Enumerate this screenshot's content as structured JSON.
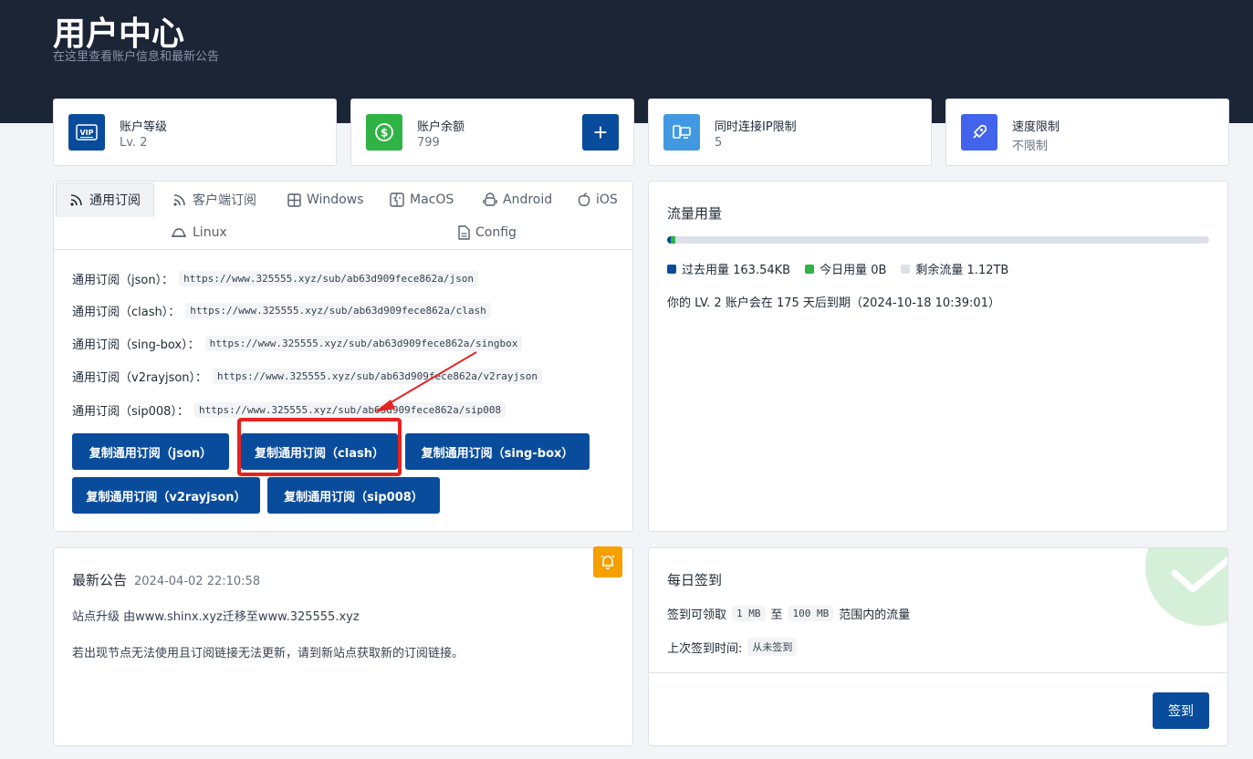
{
  "header": {
    "title": "用户中心",
    "subtitle": "在这里查看账户信息和最新公告"
  },
  "stats": [
    {
      "label": "账户等级",
      "value": "Lv. 2",
      "icon": "vip-icon",
      "color": "#0a4c9c"
    },
    {
      "label": "账户余额",
      "value": "799",
      "icon": "dollar-icon",
      "color": "#2fb344",
      "action": "+"
    },
    {
      "label": "同时连接IP限制",
      "value": "5",
      "icon": "devices-icon",
      "color": "#4299e1"
    },
    {
      "label": "速度限制",
      "value": "不限制",
      "icon": "rocket-icon",
      "color": "#4263eb"
    }
  ],
  "tabs": [
    "通用订阅",
    "客户端订阅",
    "Windows",
    "MacOS",
    "Android",
    "iOS",
    "Linux",
    "Config"
  ],
  "subscriptions": [
    {
      "label": "通用订阅（json）：",
      "url": "https://www.325555.xyz/sub/ab63d909fece862a/json"
    },
    {
      "label": "通用订阅（clash）：",
      "url": "https://www.325555.xyz/sub/ab63d909fece862a/clash"
    },
    {
      "label": "通用订阅（sing-box）：",
      "url": "https://www.325555.xyz/sub/ab63d909fece862a/singbox"
    },
    {
      "label": "通用订阅（v2rayjson）：",
      "url": "https://www.325555.xyz/sub/ab63d909fece862a/v2rayjson"
    },
    {
      "label": "通用订阅（sip008）：",
      "url": "https://www.325555.xyz/sub/ab63d909fece862a/sip008"
    }
  ],
  "copy_buttons": [
    "复制通用订阅（json）",
    "复制通用订阅（clash）",
    "复制通用订阅（sing-box）",
    "复制通用订阅（v2rayjson）",
    "复制通用订阅（sip008）"
  ],
  "traffic": {
    "title": "流量用量",
    "used_fraction": 0.001,
    "today_fraction": 0.0,
    "legend": {
      "past": "过去用量 163.54KB",
      "today": "今日用量 0B",
      "remaining": "剩余流量 1.12TB"
    },
    "colors": {
      "past": "#0a4c9c",
      "today": "#2fb344",
      "remaining": "#dde1e7"
    },
    "expire_text": "你的 LV. 2 账户会在 175 天后到期（2024-10-18 10:39:01）"
  },
  "announcement": {
    "title": "最新公告",
    "date": "2024-04-02 22:10:58",
    "lines": [
      "站点升级 由www.shinx.xyz迁移至www.325555.xyz",
      "若出现节点无法使用且订阅链接无法更新，请到新站点获取新的订阅链接。"
    ]
  },
  "checkin": {
    "title": "每日签到",
    "range_prefix": "签到可领取",
    "min": "1 MB",
    "to": "至",
    "max": "100 MB",
    "range_suffix": "范围内的流量",
    "last_label": "上次签到时间:",
    "last_value": "从未签到",
    "button": "签到"
  }
}
